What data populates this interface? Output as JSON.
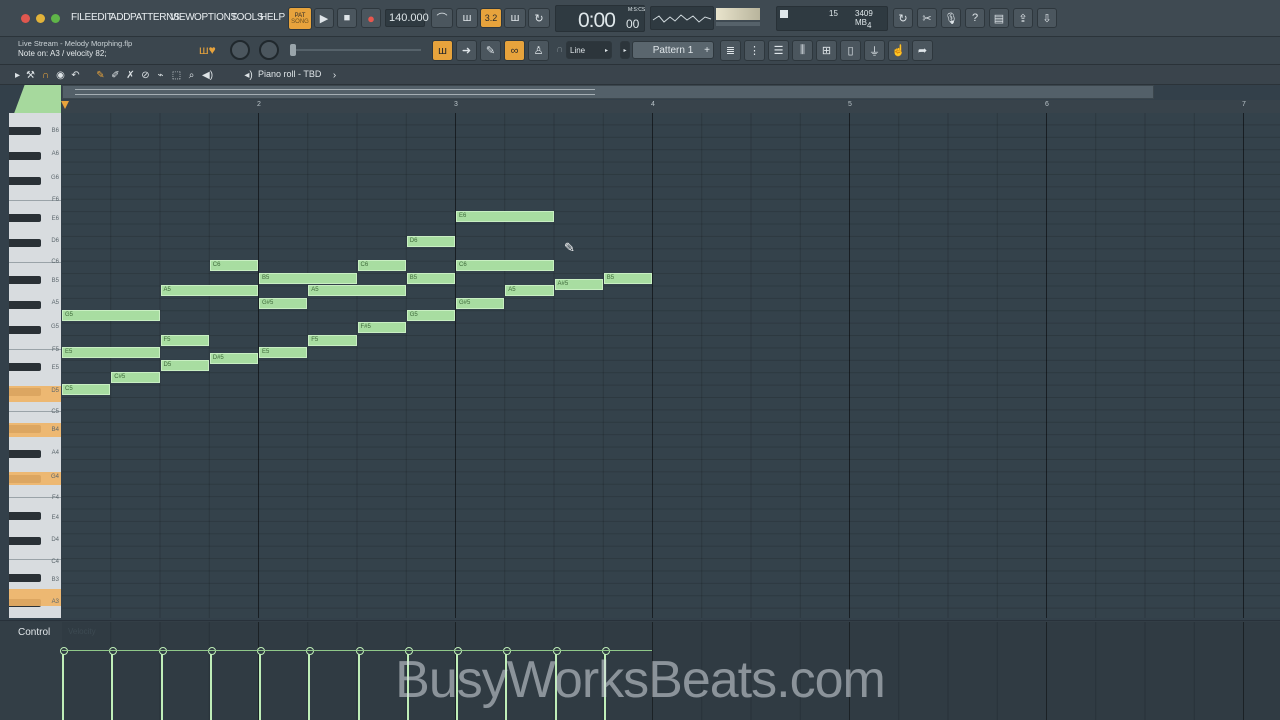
{
  "menu": [
    "FILE",
    "EDIT",
    "ADD",
    "PATTERNS",
    "VIEW",
    "OPTIONS",
    "TOOLS",
    "HELP"
  ],
  "transport": {
    "pat_label": "PAT",
    "song_label": "SONG",
    "tempo": "140.000",
    "time": "0:00",
    "time_sub": "00",
    "time_unit": "M:S:CS",
    "step_label": "3.2"
  },
  "monitor": {
    "cpu_value": "15",
    "mem_value": "3409 MB",
    "poly_value": "4"
  },
  "hint": {
    "file": "Live Stream - Melody Morphing.flp",
    "status": "Note on: A3 / velocity 82;"
  },
  "toolbar2": {
    "snap_label": "Line",
    "pattern_label": "Pattern 1"
  },
  "pianoroll": {
    "title": "Piano roll - TBD"
  },
  "ruler": [
    "2",
    "3",
    "4",
    "5",
    "6",
    "7"
  ],
  "keyboard_labels": [
    "B6",
    "A6",
    "G6",
    "F6",
    "E6",
    "D6",
    "C6",
    "B5",
    "A5",
    "G5",
    "F5",
    "E5",
    "D5",
    "C5",
    "B4",
    "A4",
    "G4",
    "F4",
    "E4",
    "D4",
    "C4",
    "B3",
    "A3"
  ],
  "notes": [
    {
      "label": "C5",
      "col": 0,
      "len": 1,
      "row": 12.0
    },
    {
      "label": "E5",
      "col": 0,
      "len": 2,
      "row": 9.0
    },
    {
      "label": "G5",
      "col": 0,
      "len": 2,
      "row": 6.0
    },
    {
      "label": "C#5",
      "col": 1,
      "len": 1,
      "row": 11.0
    },
    {
      "label": "D5",
      "col": 2,
      "len": 1,
      "row": 10.0
    },
    {
      "label": "F5",
      "col": 2,
      "len": 1,
      "row": 8.0
    },
    {
      "label": "A5",
      "col": 2,
      "len": 2,
      "row": 4.0
    },
    {
      "label": "D#5",
      "col": 3,
      "len": 1,
      "row": 9.5
    },
    {
      "label": "C6",
      "col": 3,
      "len": 1,
      "row": 2.0
    },
    {
      "label": "E5",
      "col": 4,
      "len": 1,
      "row": 9.0
    },
    {
      "label": "G#5",
      "col": 4,
      "len": 1,
      "row": 5.0
    },
    {
      "label": "B5",
      "col": 4,
      "len": 2,
      "row": 3.0
    },
    {
      "label": "F5",
      "col": 5,
      "len": 1,
      "row": 8.0
    },
    {
      "label": "A5",
      "col": 5,
      "len": 2,
      "row": 4.0
    },
    {
      "label": "F#5",
      "col": 6,
      "len": 1,
      "row": 7.0
    },
    {
      "label": "C6",
      "col": 6,
      "len": 1,
      "row": 2.0
    },
    {
      "label": "G5",
      "col": 7,
      "len": 1,
      "row": 6.0
    },
    {
      "label": "B5",
      "col": 7,
      "len": 1,
      "row": 3.0
    },
    {
      "label": "D6",
      "col": 7,
      "len": 1,
      "row": 0.0
    },
    {
      "label": "G#5",
      "col": 8,
      "len": 1,
      "row": 5.0
    },
    {
      "label": "C6",
      "col": 8,
      "len": 2,
      "row": 2.0
    },
    {
      "label": "E6",
      "col": 8,
      "len": 2,
      "row": -2.0
    },
    {
      "label": "A5",
      "col": 9,
      "len": 1,
      "row": 4.0
    },
    {
      "label": "A#5",
      "col": 10,
      "len": 1,
      "row": 3.5
    },
    {
      "label": "B5",
      "col": 11,
      "len": 1,
      "row": 3.0
    }
  ],
  "control": {
    "label": "Control",
    "target": "Velocity"
  },
  "watermark": "BusyWorksBeats.com",
  "colors": {
    "note": "#a8dda1",
    "accent": "#e7a33c",
    "grid": "#34424b"
  }
}
